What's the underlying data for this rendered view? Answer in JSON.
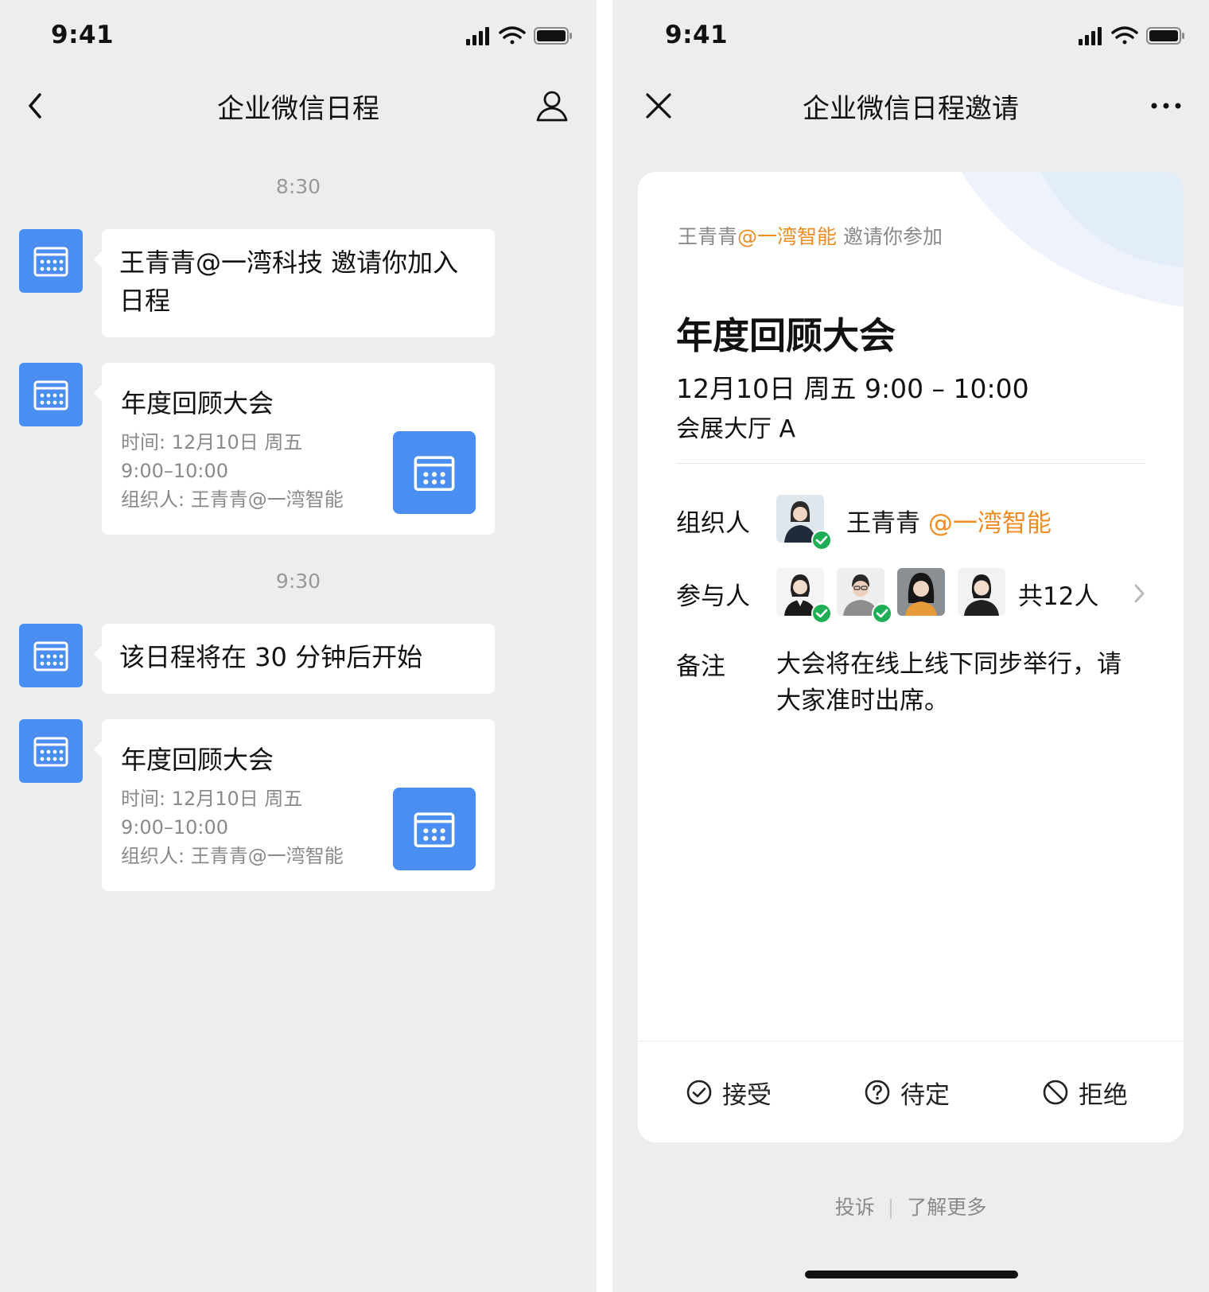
{
  "left_screen": {
    "status_time": "9:41",
    "nav_title": "企业微信日程",
    "messages": [
      {
        "type": "time",
        "text": "8:30"
      },
      {
        "type": "text",
        "text": "王青青@一湾科技 邀请你加入日程"
      },
      {
        "type": "card",
        "title": "年度回顾大会",
        "time": "时间: 12月10日  周五",
        "time_range": "9:00–10:00",
        "organizer": "组织人:  王青青@一湾智能"
      },
      {
        "type": "time",
        "text": "9:30"
      },
      {
        "type": "text",
        "text": "该日程将在 30 分钟后开始"
      },
      {
        "type": "card",
        "title": "年度回顾大会",
        "time": "时间: 12月10日  周五",
        "time_range": "9:00–10:00",
        "organizer": "组织人:  王青青@一湾智能"
      }
    ]
  },
  "right_screen": {
    "status_time": "9:41",
    "nav_title": "企业微信日程邀请",
    "inviter": {
      "name": "王青青",
      "org": "@一湾智能",
      "suffix": "邀请你参加"
    },
    "event": {
      "title": "年度回顾大会",
      "time": "12月10日  周五  9:00 – 10:00",
      "location": "会展大厅 A"
    },
    "organizer": {
      "label": "组织人",
      "name": "王青青",
      "org": "@一湾智能",
      "accepted": true
    },
    "attendees": {
      "label": "参与人",
      "count_text": "共12人",
      "avatars": [
        {
          "accepted": true
        },
        {
          "accepted": true
        },
        {
          "accepted": false
        },
        {
          "accepted": false
        }
      ]
    },
    "notes": {
      "label": "备注",
      "text": "大会将在线上线下同步举行，请大家准时出席。"
    },
    "actions": {
      "accept": "接受",
      "tentative": "待定",
      "decline": "拒绝"
    },
    "footer": {
      "report": "投诉",
      "learn_more": "了解更多"
    }
  },
  "colors": {
    "accent_blue": "#4a8ef2",
    "accent_orange": "#f08c23",
    "accepted_green": "#1fae55",
    "background": "#ededed"
  }
}
